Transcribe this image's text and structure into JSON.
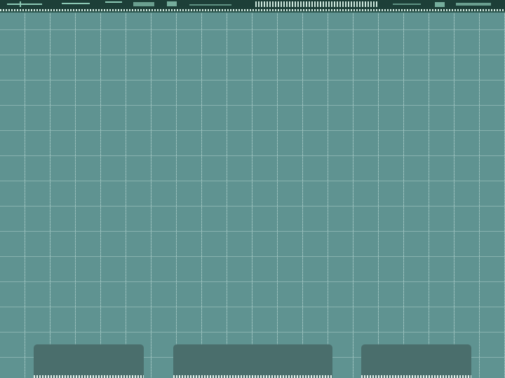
{
  "desktop": {
    "background_color": "#5f9391",
    "grid_color": "#d2ebe6"
  },
  "top_strip": {
    "background_color": "#1d3f38",
    "trace_color": "#8cc9b5"
  },
  "panels": {
    "color": "#4a6e6c",
    "items": [
      {
        "id": "left"
      },
      {
        "id": "center"
      },
      {
        "id": "right"
      }
    ]
  }
}
